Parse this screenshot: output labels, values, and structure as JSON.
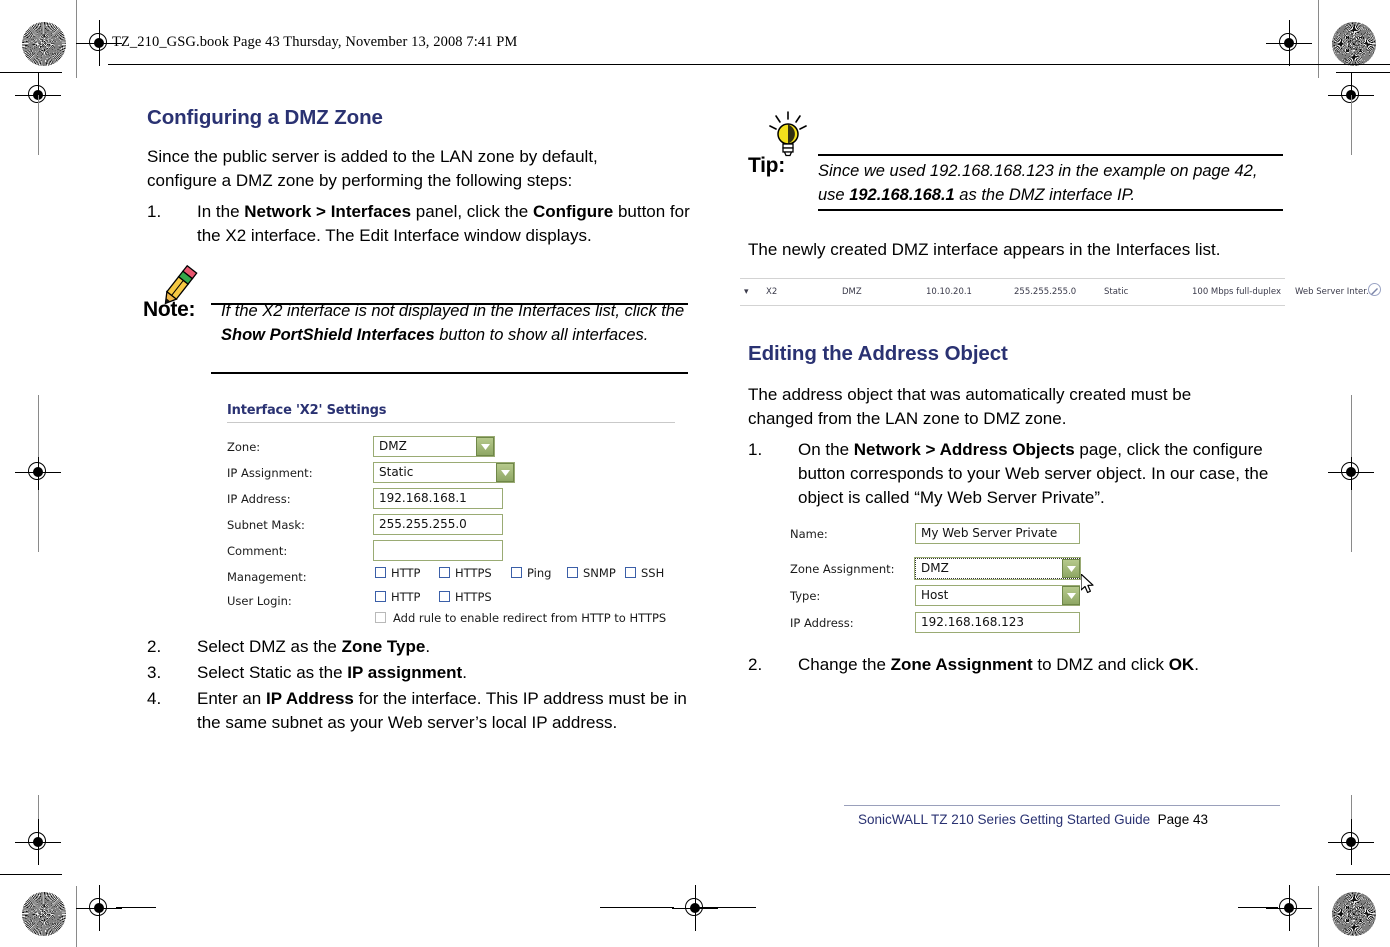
{
  "page": {
    "slug": "TZ_210_GSG.book  Page 43  Thursday, November 13, 2008  7:41 PM",
    "footer_guide": "SonicWALL TZ 210 Series Getting Started Guide",
    "footer_page": "Page 43",
    "heading_color": "#2a3272"
  },
  "left": {
    "heading": "Configuring a DMZ Zone",
    "intro_line1": "Since the public server is added to the LAN zone by default,",
    "intro_line2": "configure a DMZ zone by performing the following steps:",
    "steps": [
      {
        "num": "1.",
        "segments": [
          {
            "t": "In the ",
            "b": false
          },
          {
            "t": "Network > Interfaces",
            "b": true
          },
          {
            "t": " panel, click the ",
            "b": false
          },
          {
            "t": "Configure",
            "b": true
          },
          {
            "t": " button for the X2 interface. The Edit Interface window displays.",
            "b": false
          }
        ]
      },
      {
        "num": "2.",
        "segments": [
          {
            "t": "Select DMZ as the ",
            "b": false
          },
          {
            "t": "Zone Type",
            "b": true
          },
          {
            "t": ".",
            "b": false
          }
        ]
      },
      {
        "num": "3.",
        "segments": [
          {
            "t": "Select Static as the ",
            "b": false
          },
          {
            "t": "IP assignment",
            "b": true
          },
          {
            "t": ".",
            "b": false
          }
        ]
      },
      {
        "num": "4.",
        "segments": [
          {
            "t": "Enter an ",
            "b": false
          },
          {
            "t": "IP Address",
            "b": true
          },
          {
            "t": " for the interface. This IP address must be in the same subnet as your Web server’s local IP address.",
            "b": false
          }
        ]
      }
    ],
    "note": {
      "label": "Note:",
      "icon": "pencil-icon",
      "segments": [
        {
          "t": "If the X2 interface is not displayed in the Interfaces list, click the ",
          "b": false
        },
        {
          "t": "Show PortShield Interfaces",
          "b": true
        },
        {
          "t": " button to show all interfaces.",
          "b": false
        }
      ]
    },
    "interface_dialog": {
      "title": "Interface 'X2' Settings",
      "fields": [
        {
          "label": "Zone:",
          "value": "DMZ",
          "type": "select"
        },
        {
          "label": "IP Assignment:",
          "value": "Static",
          "type": "select"
        },
        {
          "label": "IP Address:",
          "value": "192.168.168.1",
          "type": "text"
        },
        {
          "label": "Subnet Mask:",
          "value": "255.255.255.0",
          "type": "text"
        },
        {
          "label": "Comment:",
          "value": "",
          "type": "text"
        }
      ],
      "management_label": "Management:",
      "management_options": [
        "HTTP",
        "HTTPS",
        "Ping",
        "SNMP",
        "SSH"
      ],
      "user_login_label": "User Login:",
      "user_login_options": [
        "HTTP",
        "HTTPS"
      ],
      "redirect_option": "Add rule to enable redirect from HTTP to HTTPS"
    }
  },
  "right": {
    "tip": {
      "label": "Tip:",
      "icon": "lightbulb-icon",
      "segments": [
        {
          "t": "Since we used 192.168.168.123 in the example on page 42, use ",
          "b": false
        },
        {
          "t": "192.168.168.1",
          "b": true
        },
        {
          "t": " as the DMZ interface IP.",
          "b": false
        }
      ]
    },
    "after_tip": "The newly created DMZ interface appears in the Interfaces list.",
    "interfaces_row": {
      "expander": "chevron-down-icon",
      "name": "X2",
      "zone": "DMZ",
      "ip_address": "10.10.20.1",
      "subnet_mask": "255.255.255.0",
      "ip_assignment": "Static",
      "status": "100 Mbps full-duplex",
      "comment": "Web Server Inter...",
      "configure_icon": "pencil-edit-icon"
    },
    "heading": "Editing the Address Object",
    "intro_line1": "The address object that was automatically created must be",
    "intro_line2": "changed from the LAN zone to DMZ zone.",
    "steps": [
      {
        "num": "1.",
        "segments": [
          {
            "t": "On the ",
            "b": false
          },
          {
            "t": "Network > Address Objects",
            "b": true
          },
          {
            "t": " page, click the configure button corresponds to your Web server object. In our case, the object is called “My Web Server Private”.",
            "b": false
          }
        ]
      },
      {
        "num": "2.",
        "segments": [
          {
            "t": "Change the ",
            "b": false
          },
          {
            "t": "Zone Assignment",
            "b": true
          },
          {
            "t": " to DMZ and click ",
            "b": false
          },
          {
            "t": "OK",
            "b": true
          },
          {
            "t": ".",
            "b": false
          }
        ]
      }
    ],
    "address_dialog": {
      "fields": [
        {
          "label": "Name:",
          "value": "My Web Server Private",
          "type": "text"
        },
        {
          "label": "Zone Assignment:",
          "value": "DMZ",
          "type": "select",
          "focused": true
        },
        {
          "label": "Type:",
          "value": "Host",
          "type": "select"
        },
        {
          "label": "IP Address:",
          "value": "192.168.168.123",
          "type": "text"
        }
      ]
    }
  }
}
